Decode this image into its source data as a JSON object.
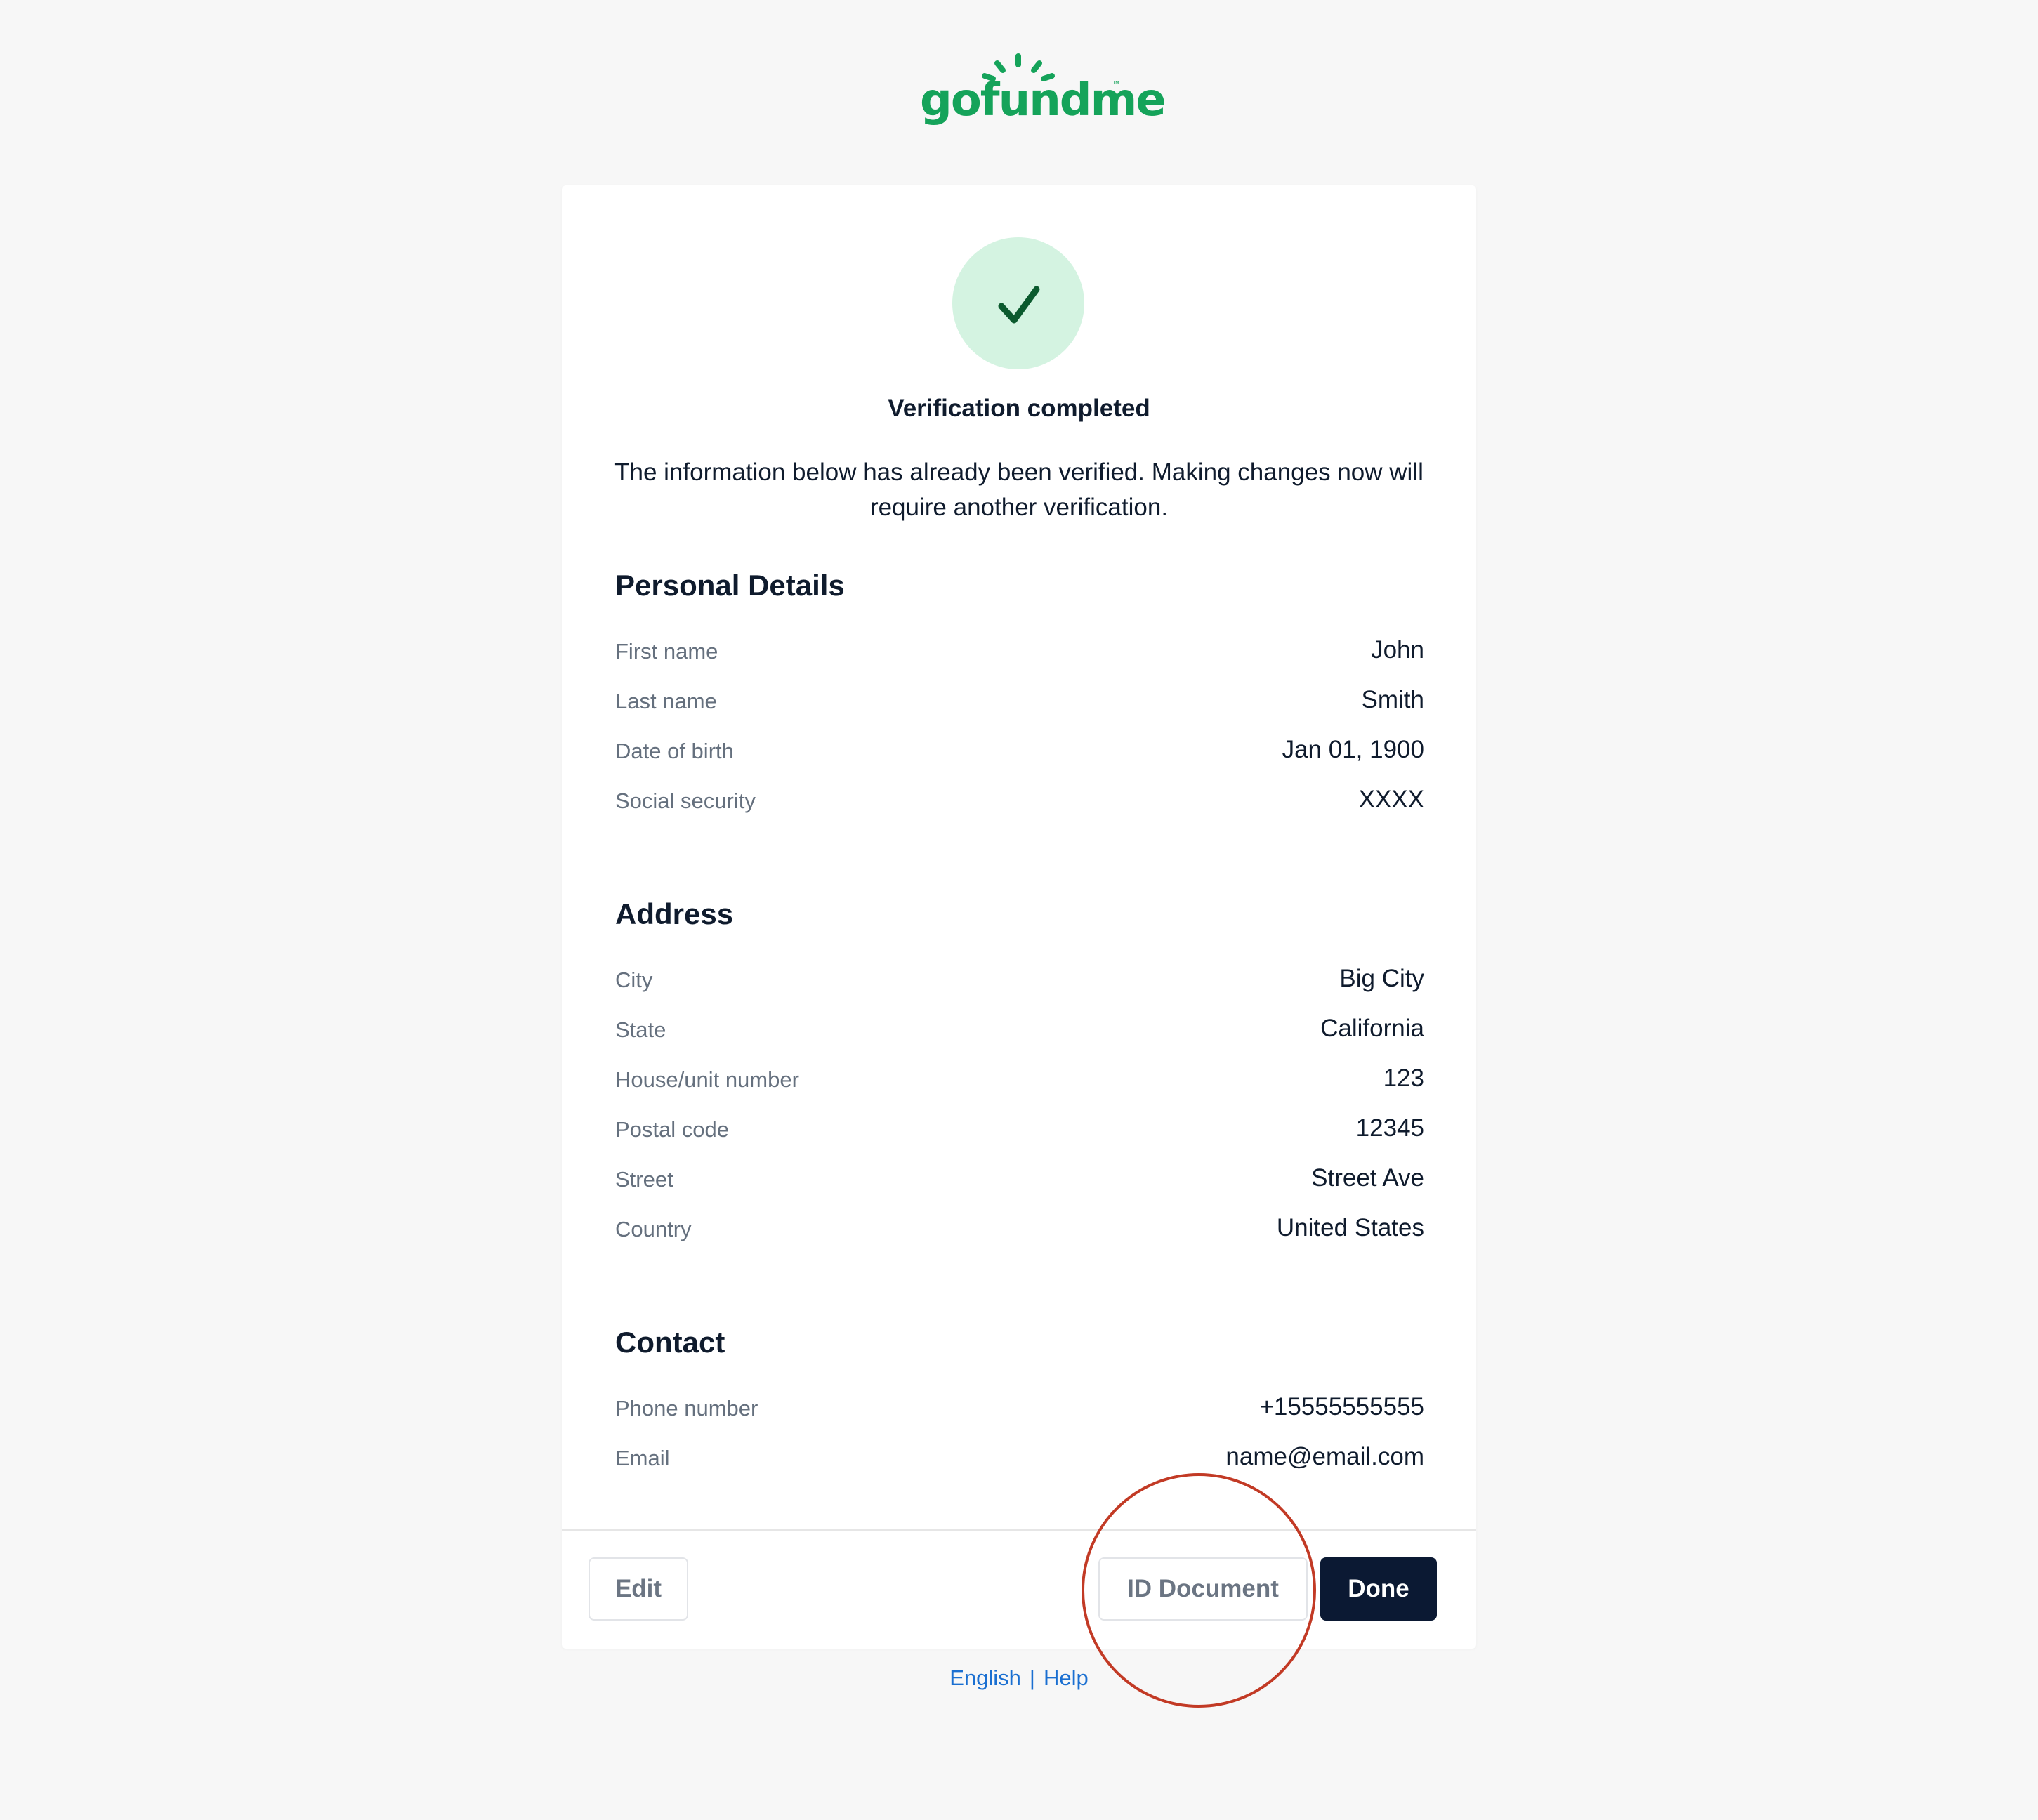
{
  "brand": {
    "name": "gofundme",
    "tm": "™",
    "color": "#15a35a"
  },
  "status": {
    "icon": "checkmark-icon",
    "title": "Verification completed",
    "message": "The information below has already been verified. Making changes now will require another verification."
  },
  "sections": {
    "personal": {
      "title": "Personal Details",
      "rows": [
        {
          "label": "First name",
          "value": "John"
        },
        {
          "label": "Last name",
          "value": "Smith"
        },
        {
          "label": "Date of birth",
          "value": "Jan 01, 1900"
        },
        {
          "label": "Social security",
          "value": "XXXX"
        }
      ]
    },
    "address": {
      "title": "Address",
      "rows": [
        {
          "label": "City",
          "value": "Big City"
        },
        {
          "label": "State",
          "value": "California"
        },
        {
          "label": "House/unit number",
          "value": "123"
        },
        {
          "label": "Postal code",
          "value": "12345"
        },
        {
          "label": "Street",
          "value": "Street Ave"
        },
        {
          "label": "Country",
          "value": "United States"
        }
      ]
    },
    "contact": {
      "title": "Contact",
      "rows": [
        {
          "label": "Phone number",
          "value": "+15555555555"
        },
        {
          "label": "Email",
          "value": "name@email.com"
        }
      ]
    }
  },
  "actions": {
    "edit": "Edit",
    "id_document": "ID Document",
    "done": "Done"
  },
  "footer": {
    "language": "English",
    "separator": "|",
    "help": "Help"
  },
  "colors": {
    "primary_button": "#0b1933",
    "success_bg": "#d4f3e1",
    "success_icon": "#0b5a2e",
    "link": "#1a6fd1",
    "highlight_ring": "#c23a25"
  }
}
